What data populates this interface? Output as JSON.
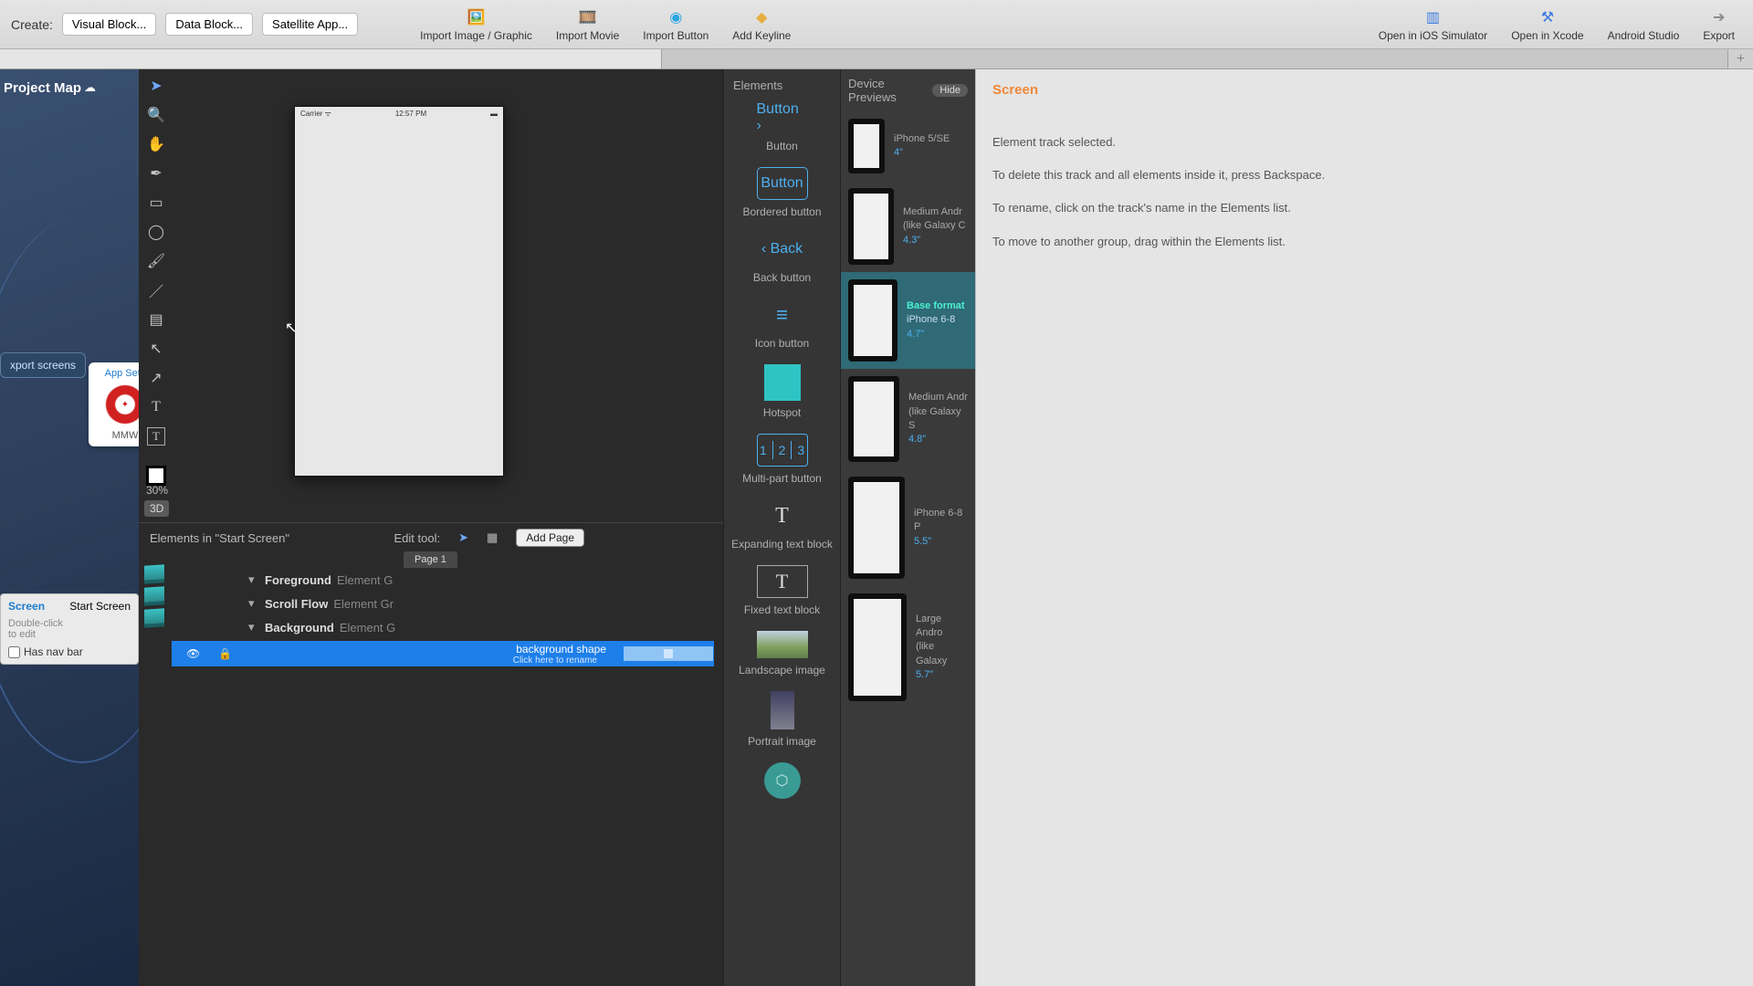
{
  "toolbar": {
    "create_label": "Create:",
    "visual_block": "Visual Block...",
    "data_block": "Data Block...",
    "satellite_app": "Satellite App...",
    "import_image": "Import Image / Graphic",
    "import_movie": "Import Movie",
    "import_button": "Import Button",
    "add_keyline": "Add Keyline",
    "open_ios": "Open in iOS Simulator",
    "open_xcode": "Open in Xcode",
    "android_studio": "Android Studio",
    "export": "Export"
  },
  "projectmap": {
    "title": "Project Map",
    "export_screens": "xport screens",
    "app_settings": "App Setti",
    "app_label": "MMW",
    "screen_title": "Screen",
    "start_screen": "Start Screen",
    "hint1": "Double-click",
    "hint2": "to edit",
    "has_nav": "Has nav bar"
  },
  "canvas": {
    "carrier": "Carrier ᯤ",
    "time": "12:57 PM",
    "zoom": "30%",
    "view3d": "3D"
  },
  "bottom": {
    "title": "Elements in \"Start Screen\"",
    "edit_tool": "Edit tool:",
    "add_page": "Add Page",
    "page1": "Page 1",
    "foreground": "Foreground",
    "scroll_flow": "Scroll Flow",
    "background": "Background",
    "group_lbl": "Element G",
    "group_lbl2": "Element Gr",
    "bgshape": "background shape",
    "rename": "Click here to rename"
  },
  "lib": {
    "title": "Elements",
    "button": "Button",
    "button_glyph": "Button ›",
    "bordered": "Bordered button",
    "back": "Back button",
    "back_glyph": "‹ Back",
    "icon_btn": "Icon button",
    "hotspot": "Hotspot",
    "multi": "Multi-part button",
    "exp_text": "Expanding text block",
    "fixed_text": "Fixed text block",
    "land": "Landscape image",
    "port": "Portrait image"
  },
  "dev": {
    "title": "Device Previews",
    "hide": "Hide",
    "d1_name": "iPhone 5/SE",
    "d1_sz": "4\"",
    "d2_name": "Medium Andr",
    "d2_name2": "(like Galaxy C",
    "d2_sz": "4.3\"",
    "d3_base": "Base format",
    "d3_name": "iPhone 6-8",
    "d3_sz": "4.7\"",
    "d4_name": "Medium Andr",
    "d4_name2": "(like Galaxy S",
    "d4_sz": "4.8\"",
    "d5_name": "iPhone 6-8 P",
    "d5_sz": "5.5\"",
    "d6_name": "Large Andro",
    "d6_name2": "(like Galaxy",
    "d6_sz": "5.7\""
  },
  "insp": {
    "title": "Screen",
    "p1": "Element track selected.",
    "p2": "To delete this track and all elements inside it, press Backspace.",
    "p3": "To rename, click on the track's name in the Elements list.",
    "p4": "To move to another group, drag within the Elements list."
  }
}
